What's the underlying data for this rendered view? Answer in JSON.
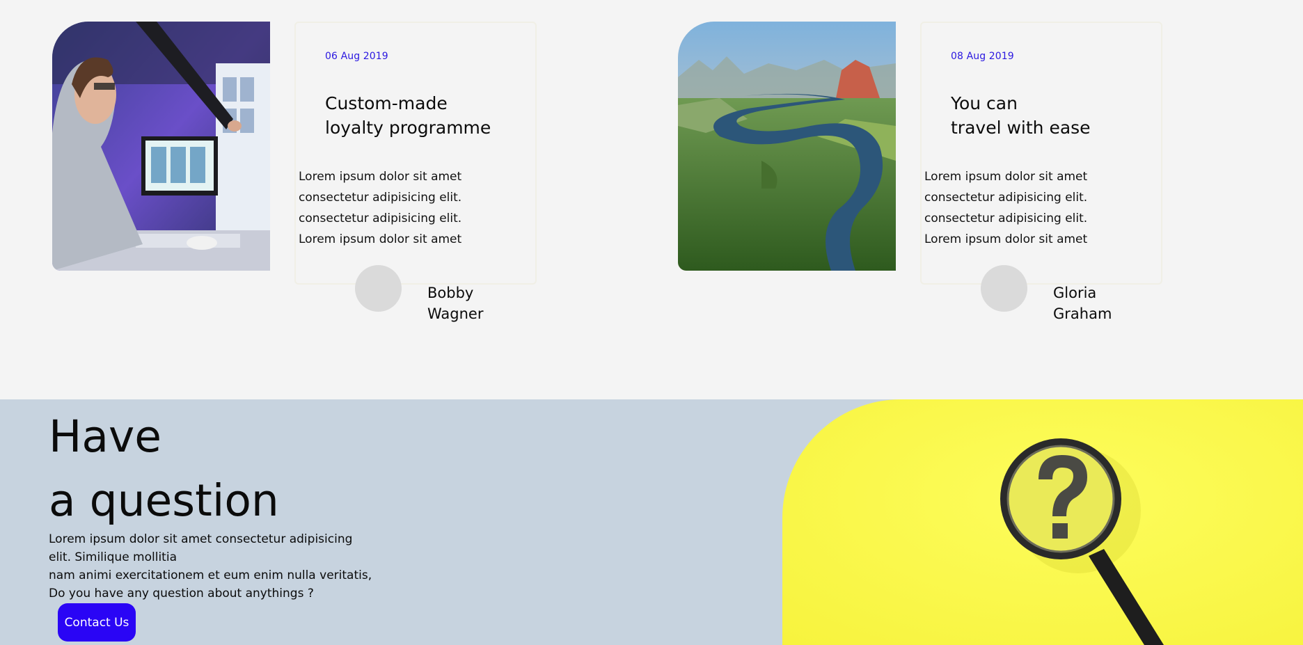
{
  "posts": [
    {
      "date": "06 Aug 2019",
      "title_line1": "Custom-made",
      "title_line2": "loyalty programme",
      "excerpt": [
        "Lorem ipsum dolor sit amet",
        "consectetur adipisicing elit.",
        "consectetur adipisicing elit.",
        "Lorem ipsum dolor sit amet"
      ],
      "author_first": "Bobby",
      "author_last": "Wagner"
    },
    {
      "date": "08 Aug 2019",
      "title_line1": "You can",
      "title_line2": "travel with ease",
      "excerpt": [
        "Lorem ipsum dolor sit amet",
        "consectetur adipisicing elit.",
        "consectetur adipisicing elit.",
        "Lorem ipsum dolor sit amet"
      ],
      "author_first": "Gloria",
      "author_last": "Graham"
    }
  ],
  "question": {
    "title_line1": "Have",
    "title_line2": "a question",
    "text": [
      "Lorem ipsum dolor sit amet consectetur adipisicing",
      "elit. Similique mollitia",
      "nam animi exercitationem et eum enim nulla veritatis,",
      "Do you have any question about anythings ?"
    ],
    "button_label": "Contact Us"
  },
  "colors": {
    "accent": "#2a05f5",
    "date": "#2a17e0",
    "page_bg": "#f4f4f4",
    "question_bg": "#c7d3df",
    "highlight_yellow": "#fbf84a"
  }
}
